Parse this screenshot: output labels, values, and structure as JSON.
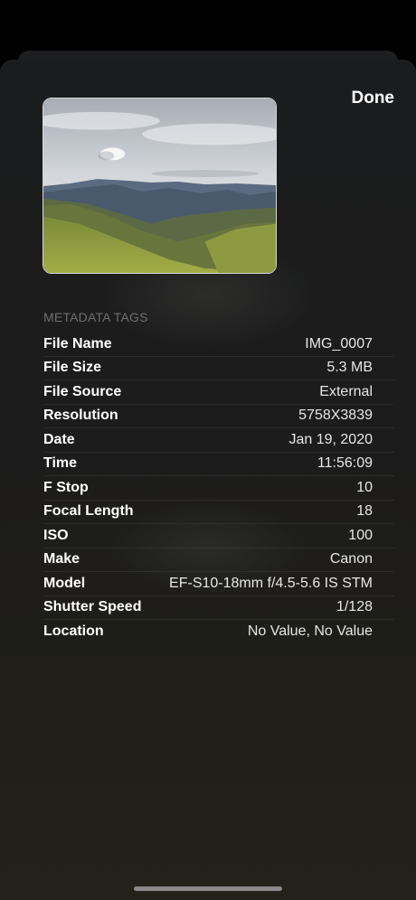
{
  "header": {
    "done_label": "Done"
  },
  "photo": {
    "description_icon": "landscape-photo"
  },
  "metadata": {
    "section_title": "METADATA TAGS",
    "rows": [
      {
        "label": "File Name",
        "value": "IMG_0007"
      },
      {
        "label": "File Size",
        "value": "5.3 MB"
      },
      {
        "label": "File Source",
        "value": "External"
      },
      {
        "label": "Resolution",
        "value": "5758X3839"
      },
      {
        "label": "Date",
        "value": "Jan 19, 2020"
      },
      {
        "label": "Time",
        "value": "11:56:09"
      },
      {
        "label": "F Stop",
        "value": "10"
      },
      {
        "label": "Focal Length",
        "value": "18"
      },
      {
        "label": "ISO",
        "value": "100"
      },
      {
        "label": "Make",
        "value": "Canon"
      },
      {
        "label": "Model",
        "value": "EF-S10-18mm f/4.5-5.6 IS STM"
      },
      {
        "label": "Shutter Speed",
        "value": "1/128"
      },
      {
        "label": "Location",
        "value": "No Value, No Value"
      }
    ]
  },
  "colors": {
    "background": "#000000",
    "sheet": "#1c1c1c",
    "text_primary": "#ffffff",
    "text_secondary": "#6f6f72"
  }
}
